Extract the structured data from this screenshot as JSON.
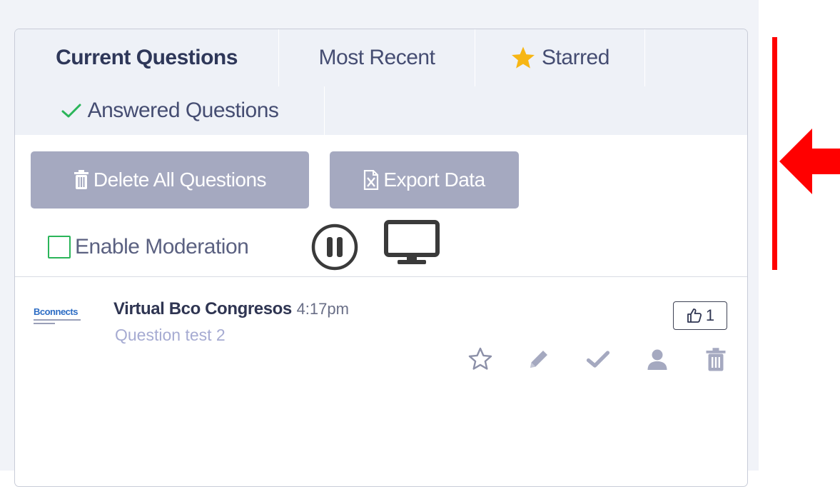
{
  "tabs": {
    "current": "Current Questions",
    "recent": "Most Recent",
    "starred": "Starred",
    "answered": "Answered Questions"
  },
  "buttons": {
    "delete_all": "Delete All Questions",
    "export": "Export Data"
  },
  "moderation": {
    "label": "Enable Moderation",
    "checked": false
  },
  "question": {
    "author": "Virtual Bco Congresos",
    "time": "4:17pm",
    "text": "Question test 2",
    "likes": "1",
    "logo_text": "Bconnects"
  },
  "icons": {
    "starred_tab": "star-icon",
    "answered_tab": "check-icon",
    "delete": "trash-icon",
    "export": "excel-file-icon",
    "pause": "pause-icon",
    "display": "monitor-icon",
    "like": "thumbs-up-icon",
    "actions": [
      "star-outline-icon",
      "pencil-icon",
      "check-icon",
      "user-icon",
      "trash-icon"
    ]
  },
  "colors": {
    "accent_annotation": "#ff0000",
    "button_bg": "#a5a9c0",
    "check_green": "#2bb55a",
    "star_yellow": "#f7b614"
  }
}
